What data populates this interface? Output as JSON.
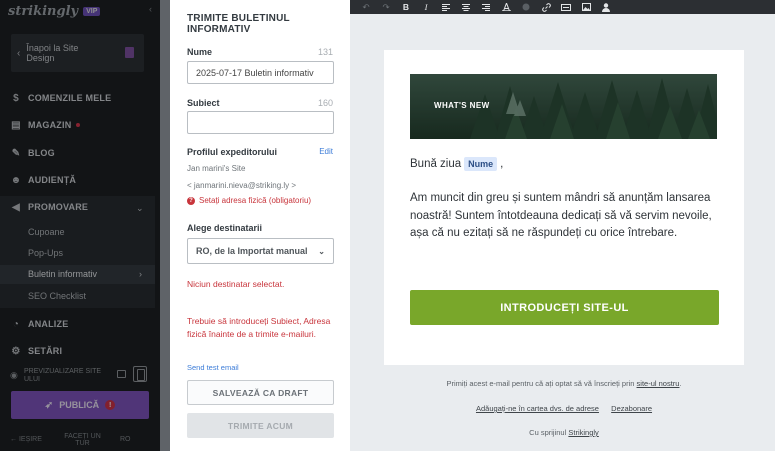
{
  "sidebar": {
    "logo": "strikingly",
    "vip": "VIP",
    "back_label": "Înapoi la Site Design",
    "nav": {
      "comenzi": "COMENZILE MELE",
      "magazin": "MAGAZIN",
      "blog": "BLOG",
      "audienta": "AUDIENȚĂ",
      "promovare": "PROMOVARE",
      "analize": "ANALIZE",
      "setari": "SETĂRI"
    },
    "sub": {
      "cupoane": "Cupoane",
      "popups": "Pop-Ups",
      "buletin": "Buletin informativ",
      "seo": "SEO Checklist"
    },
    "preview_label": "PREVIZUALIZARE SITE ULUI",
    "publish_label": "PUBLICĂ",
    "publish_warn": "!",
    "bottom": {
      "exit": "IEȘIRE",
      "faq": "FACEȚI UN TUR",
      "lang": "RO"
    }
  },
  "form": {
    "title": "TRIMITE BULETINUL INFORMATIV",
    "name_label": "Nume",
    "name_count": "131",
    "name_value": "2025-07-17 Buletin informativ",
    "subject_label": "Subiect",
    "subject_count": "160",
    "subject_value": "",
    "sender_label": "Profilul expeditorului",
    "edit_label": "Edit",
    "sender_name": "Jan marini's Site",
    "sender_email": "< janmarini.nieva@striking.ly >",
    "address_error": "Setați adresa fizică (obligatoriu)",
    "recipients_label": "Alege destinatarii",
    "recipients_value": "RO, de la Importat manual",
    "no_recipient": "Niciun destinatar selectat.",
    "must_enter": "Trebuie să introduceți Subiect, Adresa fizică înainte de a trimite e-mailuri.",
    "test_email": "Send test email",
    "save_draft": "SALVEAZĂ CA DRAFT",
    "send_now": "TRIMITE ACUM"
  },
  "email": {
    "banner_text": "WHAT'S NEW",
    "greeting": "Bună ziua",
    "name_tag": "Nume",
    "greeting_end": ",",
    "body": "Am muncit din greu și suntem mândri să anunțăm lansarea noastră! Suntem întotdeauna dedicați să vă servim nevoile, așa că nu ezitați să ne răspundeți cu orice întrebare.",
    "cta": "INTRODUCEȚI SITE-UL",
    "footer_reason": "Primiți acest e-mail pentru că ați optat să vă înscrieți prin",
    "footer_link": "site-ul nostru",
    "footer_dot": ".",
    "footer_addr": "Adăugați-ne în cartea dvs. de adrese",
    "footer_unsub": "Dezabonare",
    "footer_powered": "Cu sprijinul",
    "footer_brand": "Strikingly"
  },
  "toolbar": {
    "bold": "B",
    "italic": "I"
  },
  "colors": {
    "sidebar_bg": "#1d2023",
    "accent_purple": "#7b52b9",
    "cta_green": "#79a72a",
    "error_red": "#c8353c",
    "link_blue": "#3d7dd8"
  }
}
